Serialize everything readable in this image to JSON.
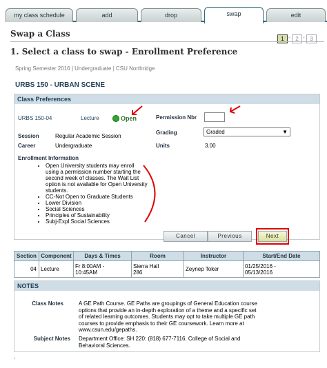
{
  "tabs": [
    {
      "label": "my class schedule",
      "active": false
    },
    {
      "label": "add",
      "active": false
    },
    {
      "label": "drop",
      "active": false
    },
    {
      "label": "swap",
      "active": true
    },
    {
      "label": "edit",
      "active": false
    }
  ],
  "page_title": "Swap a Class",
  "steps": [
    "1",
    "2",
    "3"
  ],
  "heading": "1.  Select a class to swap - Enrollment Preference",
  "breadcrumb": "Spring Semester 2016 | Undergraduate | CSU Northridge",
  "class_title": "URBS  150 - URBAN SCENE",
  "class_preferences": {
    "header": "Class Preferences",
    "section_code": "URBS  150-04",
    "component": "Lecture",
    "status": "Open",
    "permission_label": "Permission Nbr",
    "permission_value": "",
    "grading_label": "Grading",
    "grading_value": "Graded",
    "units_label": "Units",
    "units_value": "3.00",
    "session_label": "Session",
    "session_value": "Regular Academic Session",
    "career_label": "Career",
    "career_value": "Undergraduate",
    "enrollment_info_label": "Enrollment Information",
    "enrollment_info": [
      "Open University students may enroll using a permission number starting the second week of classes. The Wait List option is not available for Open University students.",
      "CC-Not Open to Graduate Students",
      "Lower Division",
      "Social Sciences",
      "Principles of Sustainability",
      "Subj-Expl Social Sciences"
    ]
  },
  "buttons": {
    "cancel": "Cancel",
    "previous": "Previous",
    "next": "Next"
  },
  "section_table": {
    "headers": [
      "Section",
      "Component",
      "Days & Times",
      "Room",
      "Instructor",
      "Start/End Date"
    ],
    "row": {
      "section": "04",
      "component": "Lecture",
      "days_times_1": "Fr 8:00AM -",
      "days_times_2": "10:45AM",
      "room_1": "Sierra Hall",
      "room_2": "286",
      "instructor": "Zeynep Toker",
      "dates_1": "01/25/2016 -",
      "dates_2": "05/13/2016"
    }
  },
  "notes": {
    "header": "NOTES",
    "class_notes_label": "Class Notes",
    "class_notes_lines": [
      "A GE Path Course. GE Paths are groupings of General Education course",
      "options that provide an in-depth exploration of a theme and a specific set",
      "of related learning outcomes. Students may opt to take multiple GE path",
      "courses to provide emphasis to their GE coursework. Learn more at",
      "www.csun.edu/gepaths."
    ],
    "subject_notes_label": "Subject Notes",
    "subject_notes_lines": [
      "Department Office: SH 220: (818) 677-7116. College of Social and",
      "Behavioral Sciences."
    ]
  },
  "colors": {
    "accent": "#2f6a7a",
    "header_bg": "#cfdee6",
    "annotation": "#e00000",
    "open_green": "#2fa82f"
  }
}
